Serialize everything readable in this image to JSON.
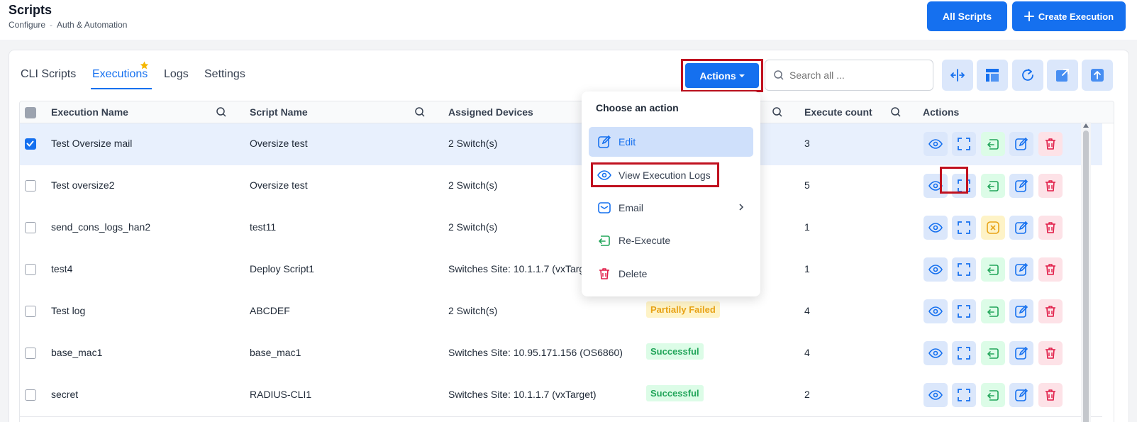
{
  "header": {
    "title": "Scripts",
    "breadcrumb": [
      "Configure",
      "-",
      "Auth & Automation"
    ],
    "all_scripts_label": "All Scripts",
    "create_execution_label": "Create Execution"
  },
  "tabs": [
    "CLI Scripts",
    "Executions",
    "Logs",
    "Settings"
  ],
  "active_tab": "Executions",
  "toolbar": {
    "actions_label": "Actions",
    "search_placeholder": "Search all ..."
  },
  "table": {
    "columns": [
      "Execution Name",
      "Script Name",
      "Assigned Devices",
      "Execute count",
      "Actions"
    ],
    "rows": [
      {
        "name": "Test Oversize mail",
        "script": "Oversize test",
        "devices": "2 Switch(s)",
        "status": "",
        "count": "3",
        "checked": true,
        "retry": "re-execute"
      },
      {
        "name": "Test oversize2",
        "script": "Oversize test",
        "devices": "2 Switch(s)",
        "status": "",
        "count": "5",
        "checked": false,
        "retry": "re-execute"
      },
      {
        "name": "send_cons_logs_han2",
        "script": "test11",
        "devices": "2 Switch(s)",
        "status": "",
        "count": "1",
        "checked": false,
        "retry": "cancel"
      },
      {
        "name": "test4",
        "script": "Deploy Script1",
        "devices": "Switches Site: 10.1.1.7 (vxTarg",
        "status": "",
        "count": "1",
        "checked": false,
        "retry": "re-execute"
      },
      {
        "name": "Test log",
        "script": "ABCDEF",
        "devices": "2 Switch(s)",
        "status": "Partially Failed",
        "count": "4",
        "checked": false,
        "retry": "re-execute"
      },
      {
        "name": "base_mac1",
        "script": "base_mac1",
        "devices": "Switches Site: 10.95.171.156 (OS6860)",
        "status": "Successful",
        "count": "4",
        "checked": false,
        "retry": "re-execute"
      },
      {
        "name": "secret",
        "script": "RADIUS-CLI1",
        "devices": "Switches Site: 10.1.1.7 (vxTarget)",
        "status": "Successful",
        "count": "2",
        "checked": false,
        "retry": "re-execute"
      }
    ]
  },
  "dropdown": {
    "title": "Choose an action",
    "items": [
      {
        "label": "Edit",
        "icon": "edit-icon"
      },
      {
        "label": "View Execution Logs",
        "icon": "eye-icon"
      },
      {
        "label": "Email",
        "icon": "mail-icon"
      },
      {
        "label": "Re-Execute",
        "icon": "re-execute-icon"
      },
      {
        "label": "Delete",
        "icon": "trash-icon"
      }
    ]
  },
  "colors": {
    "primary": "#1570ef",
    "highlight": "#c0111f",
    "success": "#22a55a",
    "warning": "#e8a317",
    "danger": "#e11d48"
  }
}
